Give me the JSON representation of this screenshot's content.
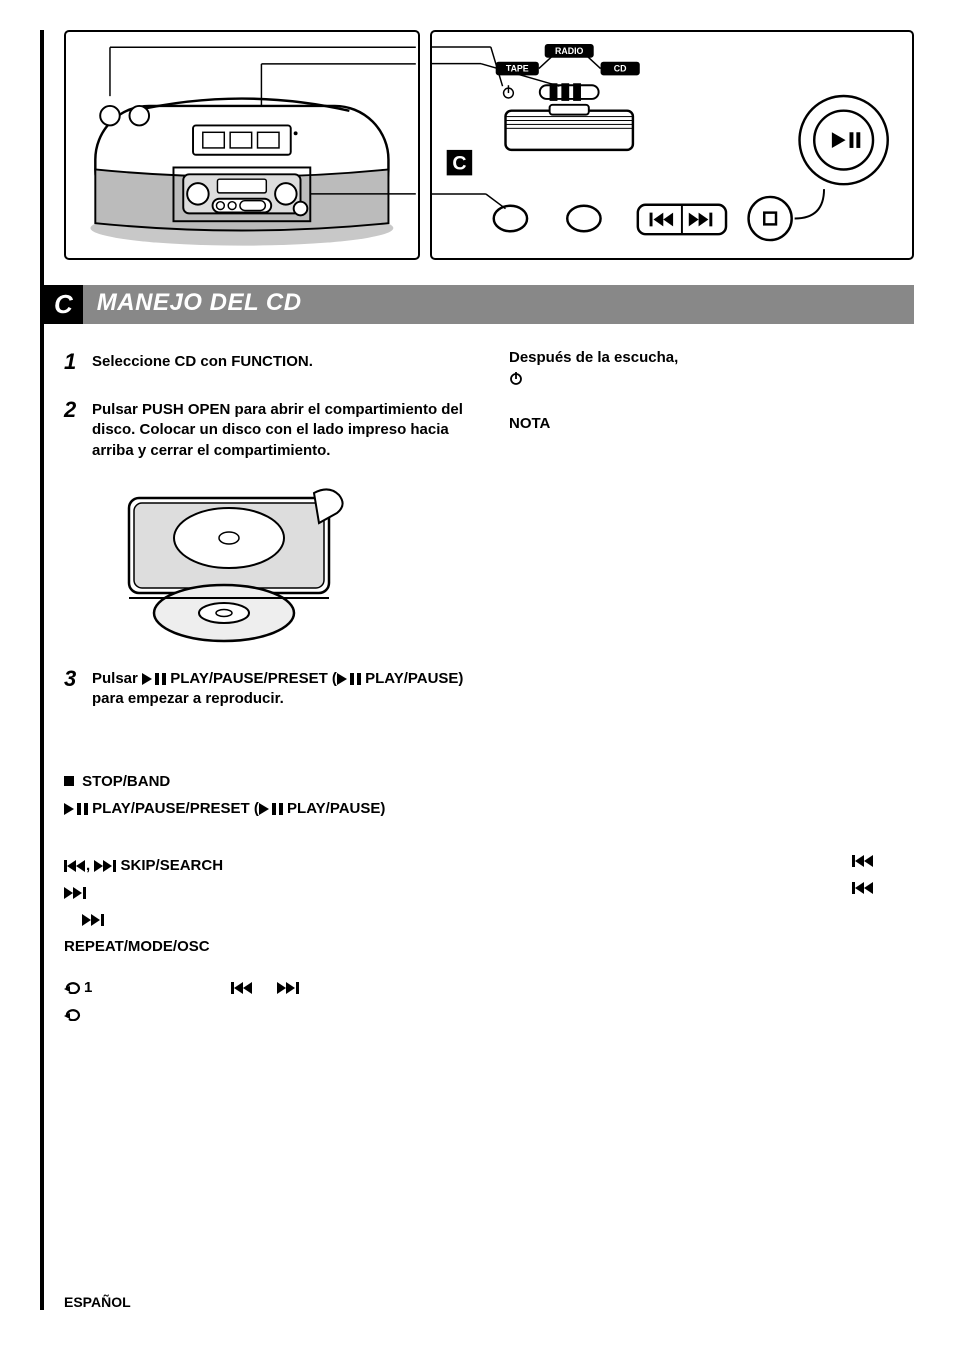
{
  "diagram_labels": {
    "radio": "RADIO",
    "tape": "TAPE",
    "cd": "CD"
  },
  "section_letter": "C",
  "section_title": "MANEJO DEL CD",
  "steps": [
    {
      "num": "1",
      "text": "Seleccione CD con FUNCTION."
    },
    {
      "num": "2",
      "text": "Pulsar PUSH OPEN para abrir el compartimiento del disco. Colocar un disco con el lado impreso hacia arriba y cerrar el compartimiento."
    },
    {
      "num": "3",
      "prefix": "Pulsar ",
      "mid1": " PLAY/PAUSE/PRESET (",
      "mid2": " PLAY/PAUSE) para empezar a reproducir."
    }
  ],
  "right_col": {
    "after_listening": "Después de la escucha,",
    "nota": "NOTA"
  },
  "body": {
    "stop_band": "STOP/BAND",
    "play_preset_a": " PLAY/PAUSE/PRESET (",
    "play_preset_b": " PLAY/PAUSE)",
    "skip_search": " SKIP/SEARCH",
    "sep": ", ",
    "repeat_mode": "REPEAT/MODE/OSC",
    "one": "1"
  },
  "footer": "ESPAÑOL"
}
